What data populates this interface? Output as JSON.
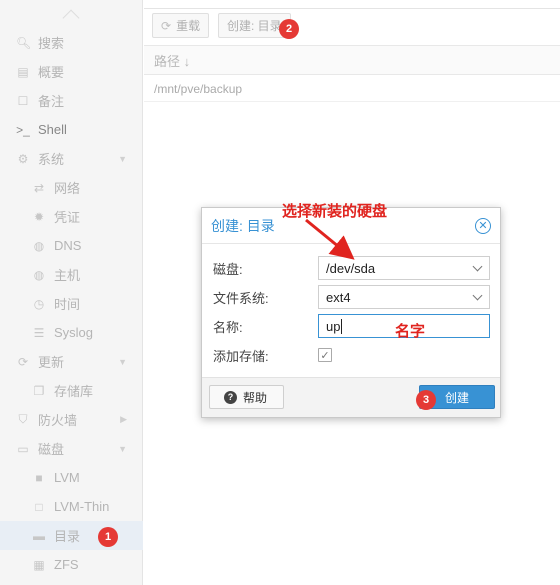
{
  "sidebar": {
    "items": [
      {
        "label": "搜索",
        "icon": "search-icon",
        "glyph": "🔍︎"
      },
      {
        "label": "概要",
        "icon": "book-icon",
        "glyph": "▤"
      },
      {
        "label": "备注",
        "icon": "note-icon",
        "glyph": "☐"
      },
      {
        "label": "Shell",
        "icon": "terminal-icon",
        "glyph": ">_"
      },
      {
        "label": "系统",
        "icon": "gears-icon",
        "glyph": "⚙"
      },
      {
        "label": "网络",
        "icon": "exchange-icon",
        "glyph": "⇄"
      },
      {
        "label": "凭证",
        "icon": "certificate-icon",
        "glyph": "✹"
      },
      {
        "label": "DNS",
        "icon": "globe-icon",
        "glyph": "◍"
      },
      {
        "label": "主机",
        "icon": "globe-icon",
        "glyph": "◍"
      },
      {
        "label": "时间",
        "icon": "clock-icon",
        "glyph": "◷"
      },
      {
        "label": "Syslog",
        "icon": "list-icon",
        "glyph": "☰"
      },
      {
        "label": "更新",
        "icon": "refresh-icon",
        "glyph": "⟳"
      },
      {
        "label": "存储库",
        "icon": "files-icon",
        "glyph": "❐"
      },
      {
        "label": "防火墙",
        "icon": "shield-icon",
        "glyph": "⛉"
      },
      {
        "label": "磁盘",
        "icon": "hdd-icon",
        "glyph": "▭"
      },
      {
        "label": "LVM",
        "icon": "square-icon",
        "glyph": "■"
      },
      {
        "label": "LVM-Thin",
        "icon": "square-outline-icon",
        "glyph": "□"
      },
      {
        "label": "目录",
        "icon": "folder-icon",
        "glyph": "▬"
      },
      {
        "label": "ZFS",
        "icon": "th-large-icon",
        "glyph": "▦"
      }
    ]
  },
  "toolbar": {
    "reload_label": "重载",
    "create_label": "创建: 目录"
  },
  "grid": {
    "header_path": "路径 ↓",
    "rows": [
      {
        "path": "/mnt/pve/backup"
      }
    ]
  },
  "dialog": {
    "title": "创建: 目录",
    "fields": {
      "disk_label": "磁盘:",
      "disk_value": "/dev/sda",
      "fs_label": "文件系统:",
      "fs_value": "ext4",
      "name_label": "名称:",
      "name_value": "up",
      "add_storage_label": "添加存储:",
      "add_storage_checked": true
    },
    "help_label": "帮助",
    "create_label": "创建"
  },
  "annotations": {
    "choose_disk": "选择新装的硬盘",
    "name_hint": "名字",
    "step1": "1",
    "step2": "2",
    "step3": "3"
  },
  "colors": {
    "accent": "#3892d4",
    "annotation_red": "#e0241f"
  }
}
